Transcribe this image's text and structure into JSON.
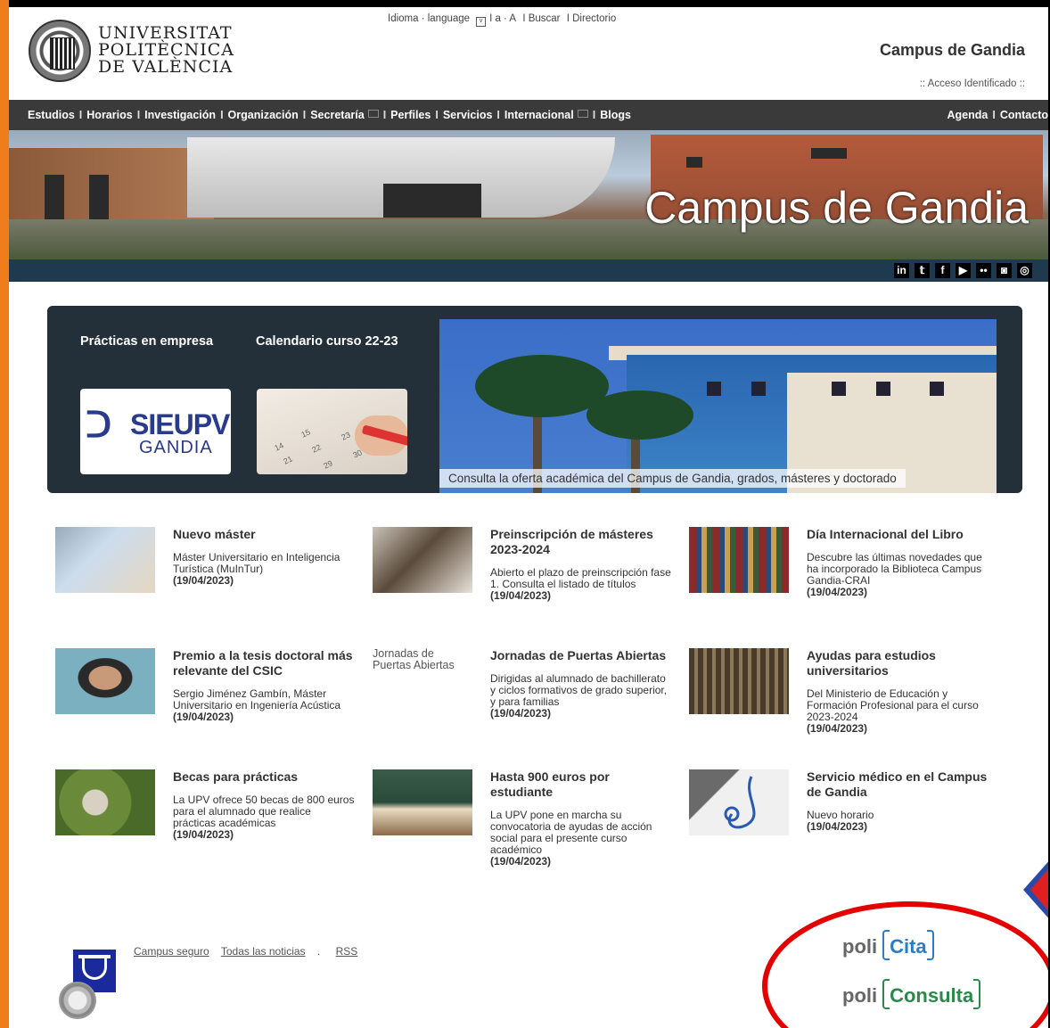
{
  "header": {
    "university_name_lines": [
      "UNIVERSITAT",
      "POLITÈCNICA",
      "DE VALÈNCIA"
    ],
    "top_links": {
      "idioma": "Idioma · language",
      "font_size": "I a · A",
      "buscar": "I Buscar",
      "directorio": "I Directorio"
    },
    "campus_title": "Campus de Gandia",
    "acceso": ":: Acceso Identificado ::"
  },
  "nav": {
    "left_items": [
      "Estudios",
      "Horarios",
      "Investigación",
      "Organización",
      "Secretaría",
      "Perfiles",
      "Servicios",
      "Internacional",
      "Blogs"
    ],
    "right_items": [
      "Agenda",
      "Contacto"
    ],
    "separator": "I"
  },
  "banner": {
    "title": "Campus de Gandia",
    "social_icons": [
      "linkedin-icon",
      "twitter-icon",
      "facebook-icon",
      "youtube-icon",
      "flickr-icon",
      "foursquare-icon",
      "instagram-icon"
    ],
    "social_glyphs": [
      "in",
      "𝕥",
      "f",
      "▶",
      "••",
      "◙",
      "◎"
    ]
  },
  "feature": {
    "label_1": "Prácticas en empresa",
    "label_2": "Calendario curso 22-23",
    "sie_mark": "ᑐ",
    "sie_text": "SIEUPV",
    "sie_sub": "GANDIA",
    "caption": "Consulta la oferta académica del Campus de Gandia, grados, másteres y doctorado"
  },
  "news": [
    {
      "title": "Nuevo máster",
      "body": "Máster Universitario en Inteligencia Turística (MuInTur)",
      "date": "(19/04/2023)"
    },
    {
      "title": "Preinscripción de másteres 2023-2024",
      "body": "Abierto el plazo de preinscripción fase 1. Consulta el listado de títulos",
      "date": "(19/04/2023)"
    },
    {
      "title": "Día Internacional del Libro",
      "body": "Descubre las últimas novedades que ha incorporado la Biblioteca Campus Gandia-CRAI",
      "date": "(19/04/2023)"
    },
    {
      "title": "Premio a la tesis doctoral más relevante del CSIC",
      "body": "Sergio Jiménez Gambín, Máster Universitario en Ingeniería Acústica",
      "date": "(19/04/2023)"
    },
    {
      "title": "Jornadas de Puertas Abiertas",
      "body": "Dirigidas al alumnado de bachillerato y ciclos formativos de grado superior, y para familias",
      "date": "(19/04/2023)",
      "broken_alt": "Jornadas de Puertas Abiertas"
    },
    {
      "title": "Ayudas para estudios universitarios",
      "body": "Del Ministerio de Educación y Formación Profesional para el curso 2023-2024",
      "date": "(19/04/2023)"
    },
    {
      "title": "Becas para prácticas",
      "body": "La UPV ofrece 50 becas de 800 euros para el alumnado que realice prácticas académicas",
      "date": "(19/04/2023)"
    },
    {
      "title": "Hasta 900 euros por estudiante",
      "body": "La UPV pone en marcha su convocatoria de ayudas de acción social para el presente curso académico",
      "date": "(19/04/2023)"
    },
    {
      "title": "Servicio médico en el Campus de Gandia",
      "body": "Nuevo horario",
      "date": "(19/04/2023)"
    }
  ],
  "footer": {
    "links": [
      "Campus seguro",
      "Todas las noticias",
      ".",
      "RSS"
    ],
    "poli_prefix": "poli",
    "cita": "Cita",
    "consulta": "Consulta"
  },
  "colors": {
    "nav_bg": "#3a3a3a",
    "feature_bg": "#233039",
    "banner_bar": "#1f3a4f",
    "annotation_red": "#e50000",
    "cita_blue": "#2a7ec8",
    "consulta_green": "#2a8a4a"
  }
}
